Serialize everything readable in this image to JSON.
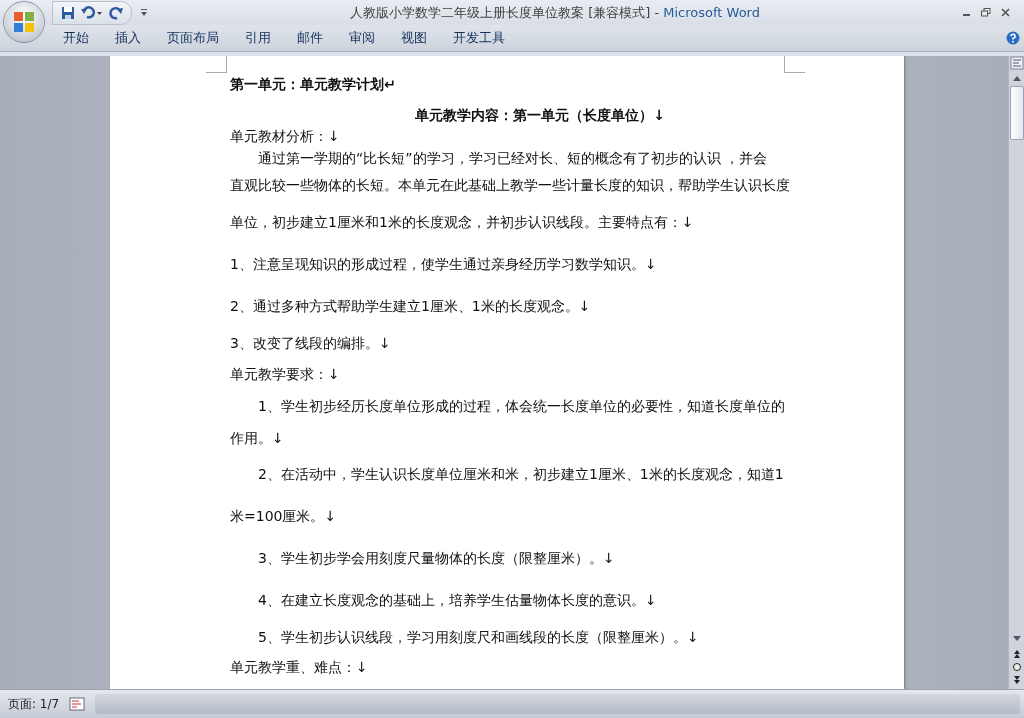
{
  "window": {
    "title": "人教版小学数学二年级上册长度单位教案 [兼容模式]",
    "separator": "-",
    "app": "Microsoft Word"
  },
  "ribbon": {
    "tabs": [
      {
        "label": "开始"
      },
      {
        "label": "插入"
      },
      {
        "label": "页面布局"
      },
      {
        "label": "引用"
      },
      {
        "label": "邮件"
      },
      {
        "label": "审阅"
      },
      {
        "label": "视图"
      },
      {
        "label": "开发工具"
      }
    ]
  },
  "document": {
    "lines": [
      {
        "kind": "title",
        "text": "第一单元：单元教学计划↵"
      },
      {
        "kind": "heading",
        "text": "单元教学内容：第一单元（长度单位）↓"
      },
      {
        "kind": "plain",
        "text": "单元教材分析：↓"
      },
      {
        "kind": "indented",
        "text": "通过第一学期的“比长短”的学习，学习已经对长、短的概念有了初步的认识 ，并会"
      },
      {
        "kind": "plain",
        "text": "直观比较一些物体的长短。本单元在此基础上教学一些计量长度的知识，帮助学生认识长度"
      },
      {
        "kind": "plain",
        "text": "单位，初步建立1厘米和1米的长度观念，并初步认识线段。主要特点有：↓"
      },
      {
        "kind": "plain",
        "text": "1、注意呈现知识的形成过程，使学生通过亲身经历学习数学知识。↓"
      },
      {
        "kind": "plain",
        "text": "2、通过多种方式帮助学生建立1厘米、1米的长度观念。↓"
      },
      {
        "kind": "plain",
        "text": "3、改变了线段的编排。↓"
      },
      {
        "kind": "plain",
        "text": "单元教学要求：↓"
      },
      {
        "kind": "indented",
        "text": "1、学生初步经历长度单位形成的过程，体会统一长度单位的必要性，知道长度单位的"
      },
      {
        "kind": "plain",
        "text": "作用。↓"
      },
      {
        "kind": "indented",
        "text": "2、在活动中，学生认识长度单位厘米和米，初步建立1厘米、1米的长度观念，知道1"
      },
      {
        "kind": "plain",
        "text": "米=100厘米。↓"
      },
      {
        "kind": "indented",
        "text": "3、学生初步学会用刻度尺量物体的长度（限整厘米）。↓"
      },
      {
        "kind": "indented",
        "text": "4、在建立长度观念的基础上，培养学生估量物体长度的意识。↓"
      },
      {
        "kind": "indented",
        "text": "5、学生初步认识线段，学习用刻度尺和画线段的长度（限整厘米）。↓"
      },
      {
        "kind": "plain",
        "text": "单元教学重、难点：↓"
      }
    ]
  },
  "status_bar": {
    "page": "页面: 1/7"
  }
}
